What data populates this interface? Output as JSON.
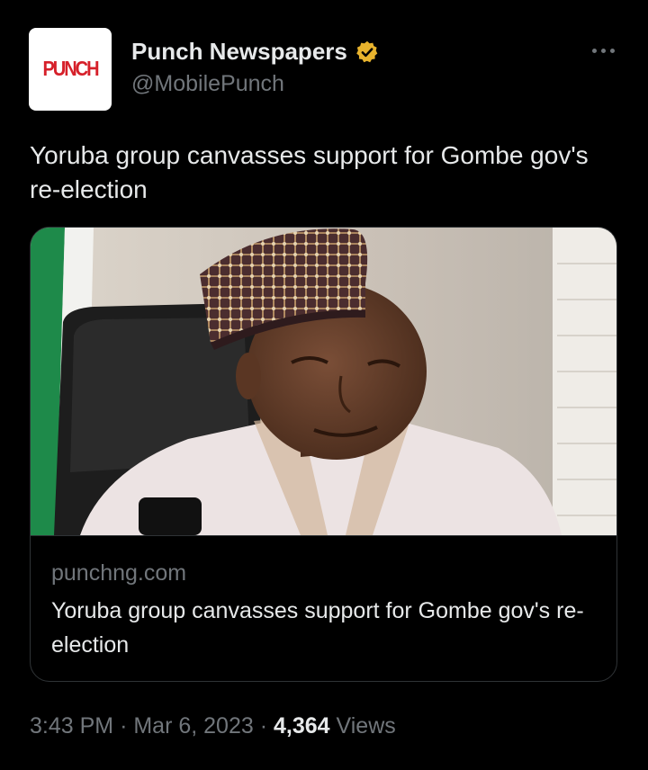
{
  "author": {
    "avatar_text": "PUNCH",
    "name": "Punch Newspapers",
    "handle": "@MobilePunch",
    "verified_icon": "verified-badge-icon"
  },
  "tweet": {
    "text": "Yoruba group canvasses support for Gombe gov's re-election"
  },
  "card": {
    "domain": "punchng.com",
    "title": "Yoruba group canvasses support for Gombe gov's re-election"
  },
  "meta": {
    "time": "3:43 PM",
    "separator": "·",
    "date": "Mar 6, 2023",
    "views_count": "4,364",
    "views_label": "Views"
  },
  "colors": {
    "background": "#000000",
    "text_primary": "#e7e9ea",
    "text_secondary": "#71767b",
    "border": "#2f3336",
    "verified_gold": "#e8b32d",
    "logo_red": "#d6202a"
  }
}
